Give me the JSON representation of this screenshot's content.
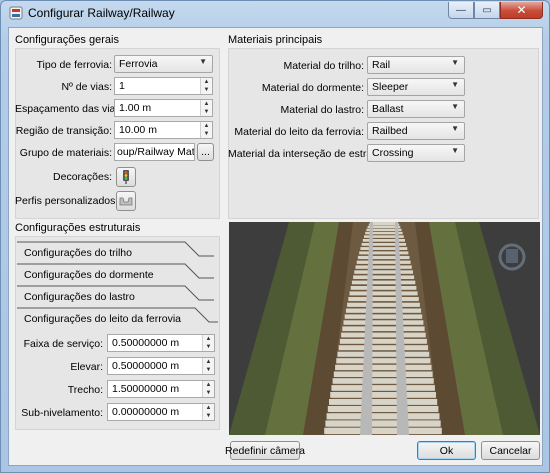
{
  "window": {
    "title": "Configurar Railway/Railway"
  },
  "controls": {
    "minimize": "—",
    "maximize": "▭",
    "close": "✕"
  },
  "general": {
    "title": "Configurações gerais",
    "railway_type_label": "Tipo de ferrovia:",
    "railway_type_value": "Ferrovia",
    "tracks_label": "Nº de vias:",
    "tracks_value": "1",
    "spacing_label": "Espaçamento das vias",
    "spacing_value": "1.00 m",
    "transition_label": "Região de transição:",
    "transition_value": "10.00 m",
    "materials_group_label": "Grupo de materiais:",
    "materials_group_value": "oup/Railway Materials",
    "browse_button": "...",
    "decorations_label": "Decorações:",
    "profiles_label": "Perfis personalizados:"
  },
  "main_materials": {
    "title": "Materiais principais",
    "rail_label": "Material do trilho:",
    "rail_value": "Rail",
    "sleeper_label": "Material do dormente:",
    "sleeper_value": "Sleeper",
    "ballast_label": "Material do lastro:",
    "ballast_value": "Ballast",
    "railbed_label": "Material do leito da ferrovia:",
    "railbed_value": "Railbed",
    "crossing_label": "Material da interseção de estrada:",
    "crossing_value": "Crossing"
  },
  "structural": {
    "title": "Configurações estruturais",
    "tabs": [
      "Configurações do trilho",
      "Configurações do dormente",
      "Configurações do lastro",
      "Configurações do leito da ferrovia"
    ],
    "service_width_label": "Faixa de serviço:",
    "service_width_value": "0.50000000 m",
    "raise_label": "Elevar:",
    "raise_value": "0.50000000 m",
    "stretch_label": "Trecho:",
    "stretch_value": "1.50000000 m",
    "sublevel_label": "Sub-nivelamento:",
    "sublevel_value": "0.00000000 m"
  },
  "buttons": {
    "reset_camera": "Redefinir câmera",
    "ok": "Ok",
    "cancel": "Cancelar"
  },
  "colors": {
    "accent": "#3c7fb1",
    "ballast_green": "#5f6a3e",
    "bed_brown": "#5d4a33",
    "sleeper": "#d9d4c8"
  },
  "icons": {
    "decorations": "traffic-light-icon",
    "profiles": "profile-shape-icon",
    "camera_gizmo": "camera-gizmo-icon"
  }
}
